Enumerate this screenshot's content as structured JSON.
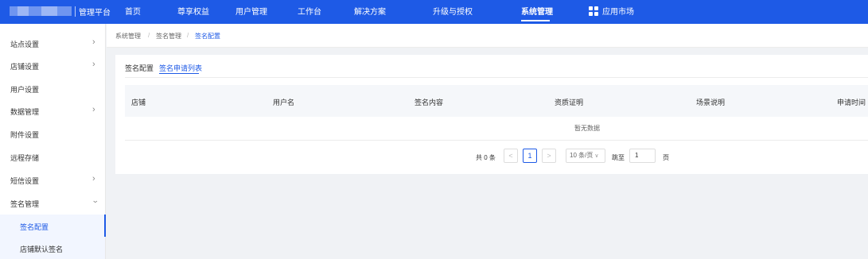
{
  "header": {
    "brand": "管理平台",
    "nav": [
      "首页",
      "尊享权益",
      "用户管理",
      "工作台",
      "解决方案",
      "升级与授权",
      "系统管理",
      "应用市场"
    ],
    "active_nav": "系统管理"
  },
  "sidebar": {
    "items": [
      {
        "label": "站点设置"
      },
      {
        "label": "店铺设置"
      },
      {
        "label": "用户设置"
      },
      {
        "label": "数据管理"
      },
      {
        "label": "附件设置"
      },
      {
        "label": "远程存储"
      },
      {
        "label": "短信设置"
      },
      {
        "label": "签名管理"
      },
      {
        "label": "签名配置"
      },
      {
        "label": "店铺默认签名"
      }
    ]
  },
  "breadcrumb": [
    "系统管理",
    "签名管理",
    "签名配置"
  ],
  "tabs": [
    "签名配置",
    "签名申请列表"
  ],
  "active_tab": "签名申请列表",
  "table": {
    "columns": [
      "店铺",
      "用户名",
      "签名内容",
      "资质证明",
      "场景说明",
      "申请时间"
    ],
    "empty_text": "暂无数据"
  },
  "pagination": {
    "total_text": "共 0 条",
    "prev": "<",
    "current_page": "1",
    "next": ">",
    "page_size": "10 条/页",
    "jump_label": "跳至",
    "jump_value": "1",
    "page_suffix": "页"
  },
  "colors": {
    "primary": "#1e5ae6",
    "background": "#f0f2f5"
  }
}
